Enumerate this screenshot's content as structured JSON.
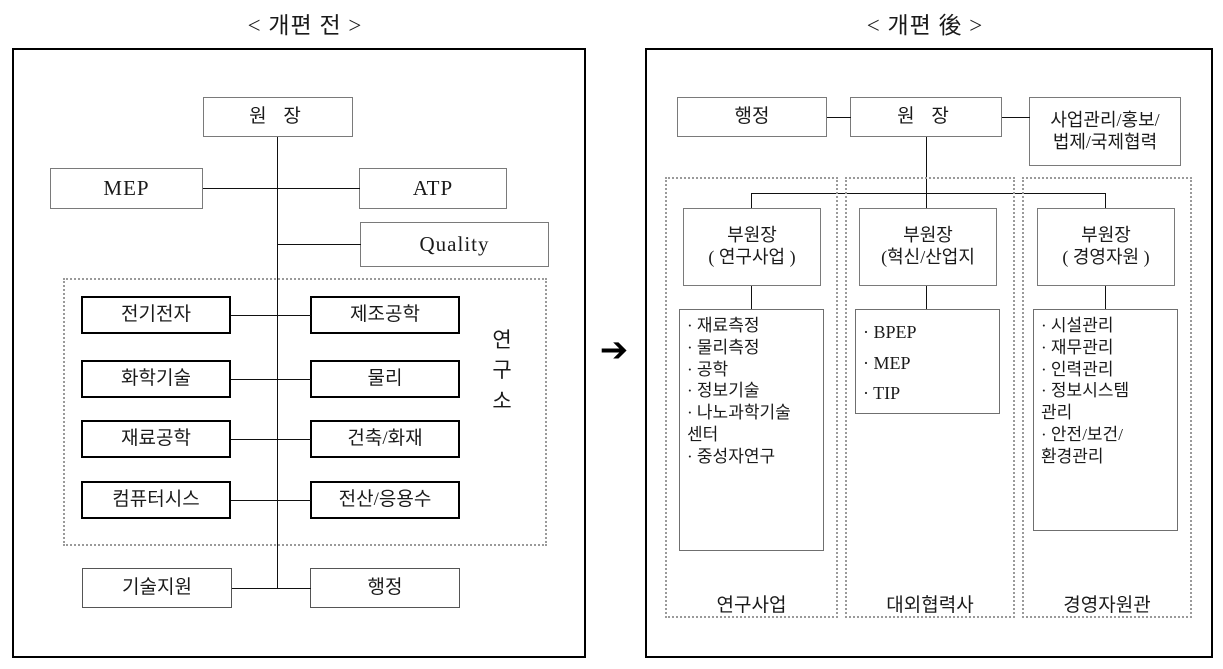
{
  "diagram": {
    "left_panel": {
      "title": "< 개편 전 >",
      "director": "원 장",
      "side_nodes": [
        {
          "id": "mep",
          "label": "MEP"
        },
        {
          "id": "atp",
          "label": "ATP"
        },
        {
          "id": "quality",
          "label": "Quality"
        }
      ],
      "institute_group_label": "연구소",
      "institute_vertical_chars": [
        "연",
        "구",
        "소"
      ],
      "institute_rows": [
        {
          "left": "전기전자",
          "right": "제조공학"
        },
        {
          "left": "화학기술",
          "right": "물리"
        },
        {
          "left": "재료공학",
          "right": "건축/화재"
        },
        {
          "left": "컴퓨터시스",
          "right": "전산/응용수"
        }
      ],
      "bottom_row": {
        "left": "기술지원",
        "right": "행정"
      }
    },
    "transition_arrow": "➔",
    "right_panel": {
      "title": "< 개편 後 >",
      "director": "원 장",
      "admin": "행정",
      "staff_office": "사업관리/홍보/법제/국제협력",
      "staff_office_lines": [
        "사업관리/홍보/",
        "법제/국제협력"
      ],
      "columns": [
        {
          "id": "research",
          "deputy_line1": "부원장",
          "deputy_line2": "( 연구사업 )",
          "items": [
            "· 재료측정",
            "· 물리측정",
            "· 공학",
            "· 정보기술",
            "·   나노과학기술",
            "   센터",
            "· 중성자연구"
          ],
          "caption": "연구사업"
        },
        {
          "id": "innovation",
          "deputy_line1": "부원장",
          "deputy_line2": "(혁신/산업지",
          "items": [
            "· BPEP",
            "· MEP",
            "· TIP"
          ],
          "caption": "대외협력사"
        },
        {
          "id": "management",
          "deputy_line1": "부원장",
          "deputy_line2": "( 경영자원 )",
          "items": [
            "· 시설관리",
            "· 재무관리",
            "· 인력관리",
            "· 정보시스템",
            "  관리",
            "· 안전/보건/",
            "  환경관리"
          ],
          "caption": "경영자원관"
        }
      ]
    },
    "colors": {
      "line": "#111111",
      "box_border": "#7a7a7a",
      "bold_border": "#000000",
      "dotted_border": "#9a9a9a",
      "background": "#ffffff"
    }
  }
}
